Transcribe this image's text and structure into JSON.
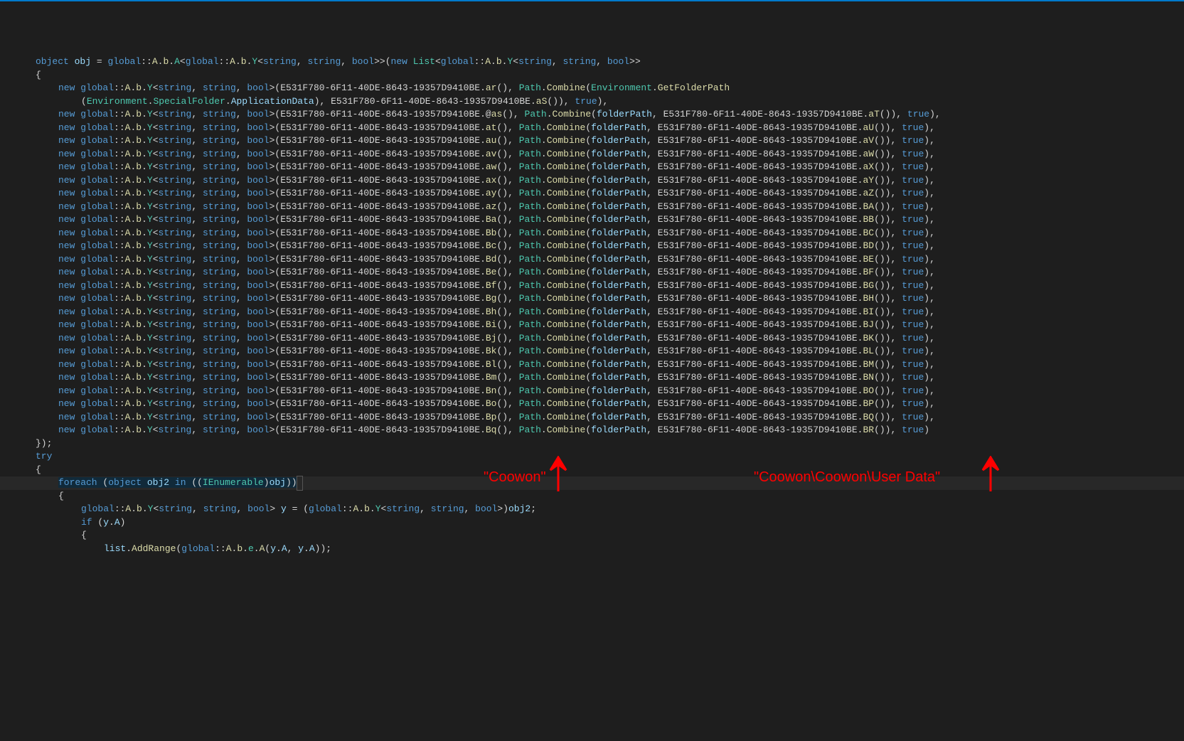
{
  "guid": "E531F780-6F11-40DE-8643-19357D9410BE",
  "head": {
    "decl_pre": "object obj = ",
    "kw_global": "global",
    "A": "A",
    "b": "b",
    "Aclass": "A",
    "Y": "Y",
    "string": "string",
    "bool": "bool",
    "new": "new",
    "List": "List",
    "open_brace": "{"
  },
  "first_line": {
    "ar": "ar",
    "Path": "Path",
    "Combine": "Combine",
    "Environment": "Environment",
    "GetFolderPath": "GetFolderPath",
    "SpecialFolder": "SpecialFolder",
    "ApplicationData": "ApplicationData",
    "aS": "aS",
    "true": "true"
  },
  "rows": [
    {
      "m1": "@as",
      "m2": "aT",
      "at_prefix": true
    },
    {
      "m1": "at",
      "m2": "aU"
    },
    {
      "m1": "au",
      "m2": "aV"
    },
    {
      "m1": "av",
      "m2": "aW"
    },
    {
      "m1": "aw",
      "m2": "aX"
    },
    {
      "m1": "ax",
      "m2": "aY"
    },
    {
      "m1": "ay",
      "m2": "aZ"
    },
    {
      "m1": "az",
      "m2": "BA"
    },
    {
      "m1": "Ba",
      "m2": "BB"
    },
    {
      "m1": "Bb",
      "m2": "BC"
    },
    {
      "m1": "Bc",
      "m2": "BD"
    },
    {
      "m1": "Bd",
      "m2": "BE"
    },
    {
      "m1": "Be",
      "m2": "BF"
    },
    {
      "m1": "Bf",
      "m2": "BG"
    },
    {
      "m1": "Bg",
      "m2": "BH"
    },
    {
      "m1": "Bh",
      "m2": "BI"
    },
    {
      "m1": "Bi",
      "m2": "BJ"
    },
    {
      "m1": "Bj",
      "m2": "BK"
    },
    {
      "m1": "Bk",
      "m2": "BL"
    },
    {
      "m1": "Bl",
      "m2": "BM"
    },
    {
      "m1": "Bm",
      "m2": "BN"
    },
    {
      "m1": "Bn",
      "m2": "BO"
    },
    {
      "m1": "Bo",
      "m2": "BP"
    },
    {
      "m1": "Bp",
      "m2": "BQ"
    },
    {
      "m1": "Bq",
      "m2": "BR",
      "last": true
    }
  ],
  "tail": {
    "close": "});",
    "try": "try",
    "open_brace": "{",
    "foreach": "foreach",
    "object": "object",
    "obj2": "obj2",
    "in": "in",
    "IEnumerable": "IEnumerable",
    "obj": "obj",
    "ytype_pre": "global::",
    "ydecl": "y",
    "cast_pre": "(",
    "ifkw": "if",
    "yA": "y.A",
    "list": "list",
    "AddRange": "AddRange",
    "ecls": "e",
    "Amethod": "A",
    "yA1": "y.A",
    "yA2": "y.A"
  },
  "labels": {
    "folderPath": "folderPath",
    "true": "true",
    "new": "new",
    "global": "global",
    "Path": "Path",
    "Combine": "Combine"
  },
  "annotations": {
    "left_text": "\"Coowon\"",
    "right_text": "\"Coowon\\Coowon\\User Data\""
  }
}
